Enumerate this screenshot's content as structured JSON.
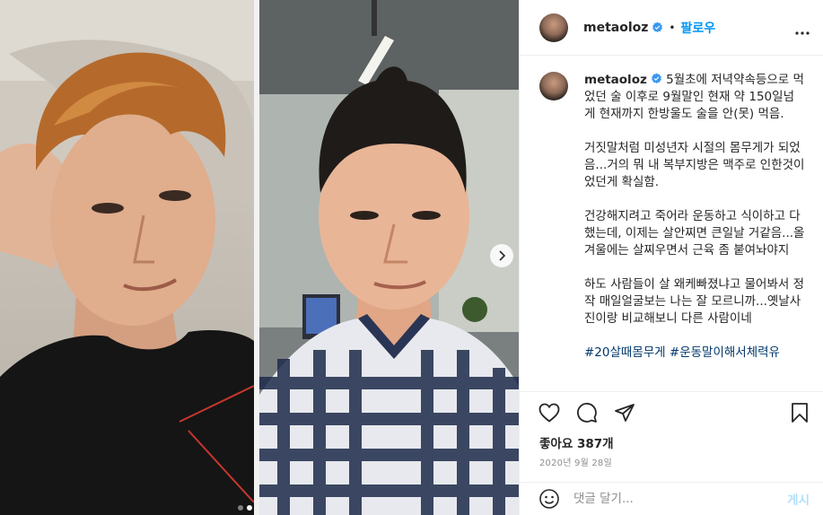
{
  "post": {
    "username": "metaoloz",
    "follow_label": "팔로우",
    "separator": "•",
    "likes": "좋아요 387개",
    "date": "2020년 9월 28일",
    "comment_placeholder": "댓글 달기...",
    "post_label": "게시",
    "carousel_total_slides": 2,
    "carousel_active_slide": 2
  },
  "caption": {
    "username": "metaoloz",
    "paragraphs": [
      "5월초에 저녁약속등으로 먹었던 술 이후로 9월말인 현재 약 150일넘게 현재까지 한방울도 술을 안(못) 먹음.",
      "거짓말처럼 미성년자 시절의 몸무게가 되었음...거의 뭐 내 복부지방은 맥주로 인한것이었던게 확실함.",
      "건강해지려고 죽어라 운동하고 식이하고 다했는데, 이제는 살안찌면 큰일날 거같음...올겨울에는 살찌우면서 근육 좀 붙여놔야지",
      "하도 사람들이 살 왜케빠졌냐고 물어봐서 정작 매일얼굴보는 나는 잘 모르니까...옛날사진이랑 비교해보니 다른 사람이네",
      "#20살때몸무게 #운동말이해서체력유"
    ]
  },
  "colors": {
    "link_blue": "#0095f6",
    "verified_blue": "#3897f0",
    "text": "#262626",
    "muted": "#8e8e8e",
    "border": "#efefef",
    "post_disabled": "#b2dffc"
  }
}
